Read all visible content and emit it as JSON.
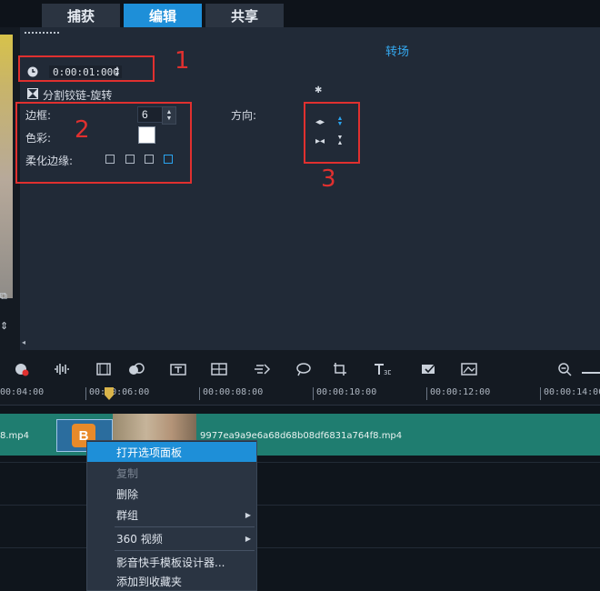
{
  "tabs": [
    {
      "label": "捕获",
      "active": false
    },
    {
      "label": "编辑",
      "active": true
    },
    {
      "label": "共享",
      "active": false
    }
  ],
  "panel": {
    "title": "转场",
    "duration": "0:00:01:000",
    "transition_name": "分割铰链-旋转",
    "border_label": "边框:",
    "border_value": "6",
    "color_label": "色彩:",
    "color_value": "#ffffff",
    "soften_label": "柔化边缘:",
    "soften_selected_index": 3,
    "direction_label": "方向:",
    "direction_selected_index": 1
  },
  "annotations": [
    "1",
    "2",
    "3"
  ],
  "timeline": {
    "ruler": [
      "00:04:00",
      "00:00:06:00",
      "00:00:08:00",
      "00:00:10:00",
      "00:00:12:00",
      "00:00:14:00"
    ],
    "clip_left_name": "8.mp4",
    "clip_name": "9977ea9a9e6a68d68b08df6831a764f8.mp4",
    "transition_letter": "B"
  },
  "context_menu": {
    "items": [
      {
        "label": "打开选项面板",
        "highlighted": true,
        "disabled": false,
        "submenu": false
      },
      {
        "label": "复制",
        "highlighted": false,
        "disabled": true,
        "submenu": false
      },
      {
        "label": "删除",
        "highlighted": false,
        "disabled": false,
        "submenu": false
      },
      {
        "label": "群组",
        "highlighted": false,
        "disabled": false,
        "submenu": true
      },
      {
        "label": "360 视频",
        "highlighted": false,
        "disabled": false,
        "submenu": true
      },
      {
        "label": "影音快手模板设计器...",
        "highlighted": false,
        "disabled": false,
        "submenu": false
      },
      {
        "label": "添加到收藏夹",
        "highlighted": false,
        "disabled": false,
        "submenu": false
      }
    ]
  },
  "colors": {
    "accent": "#1e8fd8",
    "annotation": "#e0302f",
    "clip": "#1f7d70"
  }
}
